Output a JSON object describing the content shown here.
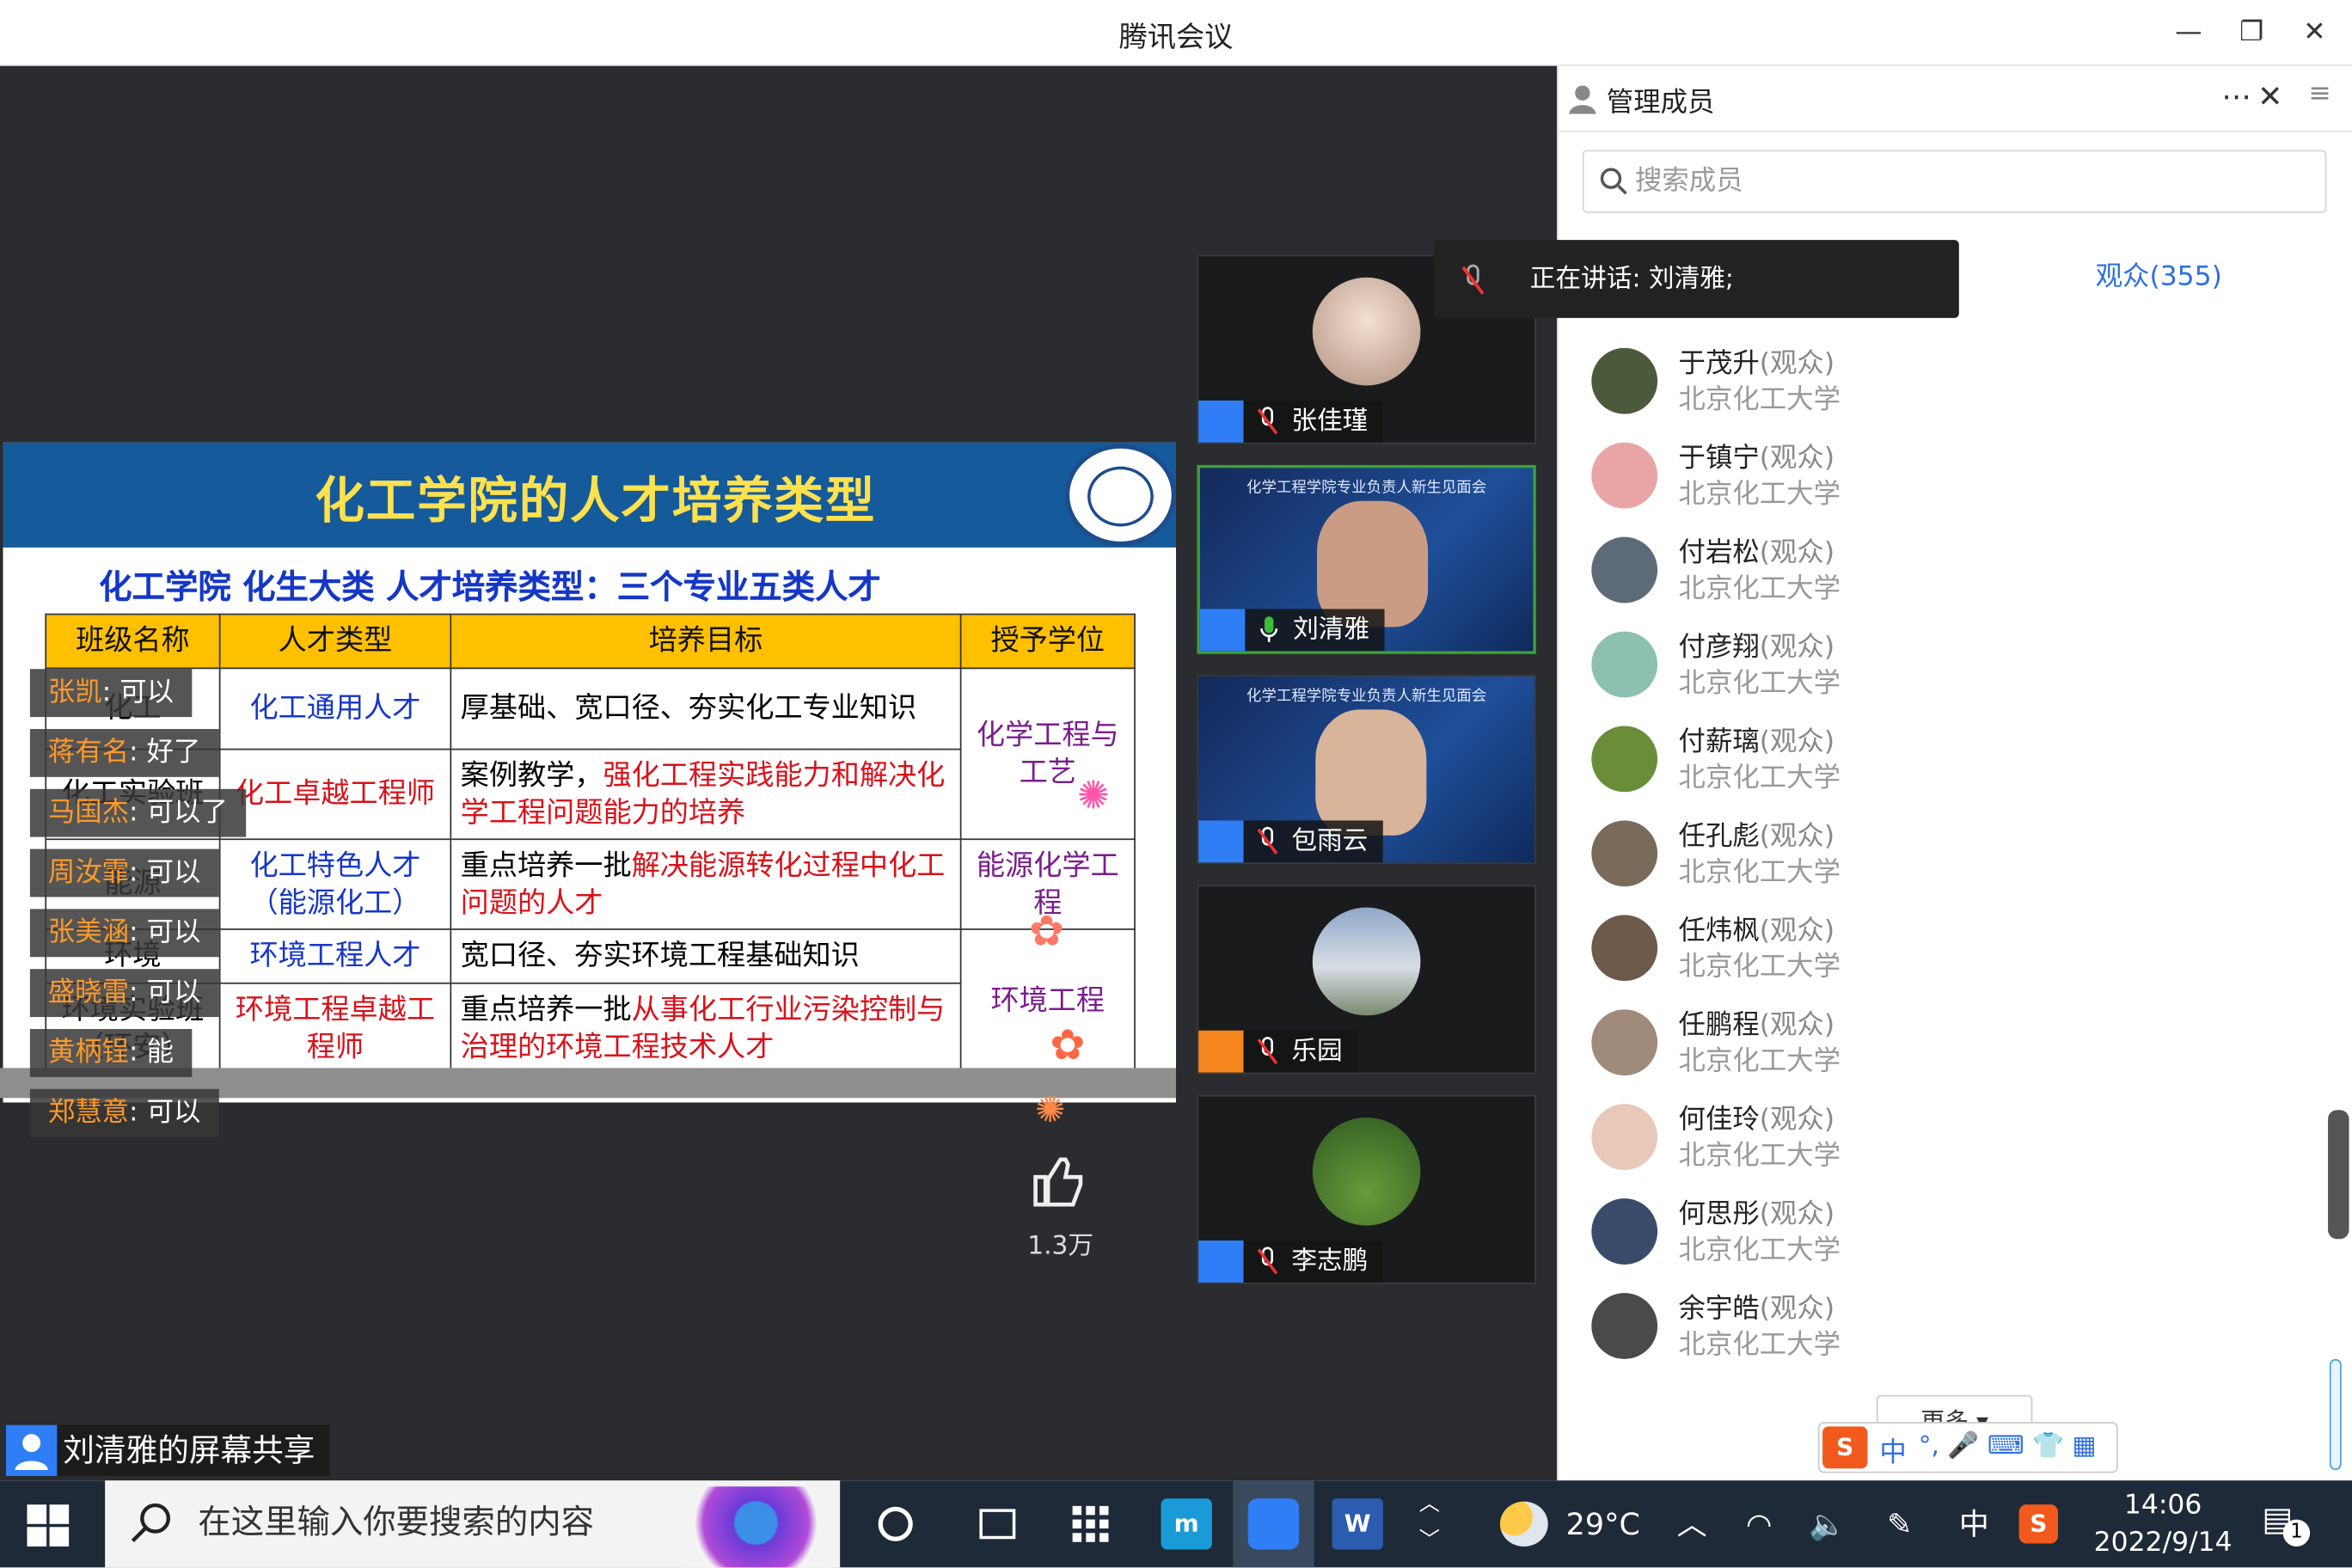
{
  "window": {
    "title": "腾讯会议"
  },
  "slide": {
    "title": "化工学院的人才培养类型",
    "subtitle": "化工学院 化生大类 人才培养类型：三个专业五类人才",
    "headers": [
      "班级名称",
      "人才类型",
      "培养目标",
      "授予学位"
    ],
    "rows": [
      {
        "cls": "化工",
        "type": "化工通用人才",
        "goal_a": "厚基础、宽口径、夯实化工专业知识",
        "goal_b": ""
      },
      {
        "cls": "化工实验班",
        "type": "化工卓越工程师",
        "goal_a": "案例教学，",
        "goal_b": "强化工程实践能力和解决化学工程问题能力的培养"
      },
      {
        "cls": "能源",
        "type": "化工特色人才（能源化工）",
        "goal_a": "重点培养一批",
        "goal_b": "解决能源转化过程中化工问题的人才"
      },
      {
        "cls": "环境",
        "type": "环境工程人才",
        "goal_a": "宽口径、夯实环境工程基础知识",
        "goal_b": ""
      },
      {
        "cls": "环境实验班（环安）",
        "type": "环境工程卓越工程师",
        "goal_a": "重点培养一批",
        "goal_b": "从事化工行业污染控制与治理的环境工程技术人才"
      }
    ],
    "degrees": [
      "化学工程与工艺",
      "能源化学工程",
      "环境工程"
    ]
  },
  "chat": [
    {
      "name": "张凯",
      "sep": ": ",
      "msg": "可以"
    },
    {
      "name": "蒋有名",
      "sep": ": ",
      "msg": "好了"
    },
    {
      "name": "马国杰",
      "sep": ": ",
      "msg": "可以了"
    },
    {
      "name": "周汝霏",
      "sep": ": ",
      "msg": "可以"
    },
    {
      "name": "张美涵",
      "sep": ": ",
      "msg": "可以"
    },
    {
      "name": "盛晓雷",
      "sep": ": ",
      "msg": "可以"
    },
    {
      "name": "黄柄锃",
      "sep": ": ",
      "msg": "能"
    },
    {
      "name": "郑慧意",
      "sep": ": ",
      "msg": "可以"
    }
  ],
  "likes": {
    "count": "1.3万"
  },
  "sharer": {
    "label": "刘清雅的屏幕共享"
  },
  "tiles": [
    {
      "name": "张佳瑾",
      "video_title": ""
    },
    {
      "name": "刘清雅",
      "video_title": "化学工程学院专业负责人新生见面会"
    },
    {
      "name": "包雨云",
      "video_title": "化学工程学院专业负责人新生见面会"
    },
    {
      "name": "乐园",
      "video_title": ""
    },
    {
      "name": "李志鹏",
      "video_title": ""
    }
  ],
  "speaking": {
    "text": "正在讲话: 刘清雅;"
  },
  "panel": {
    "title": "管理成员",
    "search_placeholder": "搜索成员",
    "audience_tab": "观众(355)",
    "more": "更多",
    "members": [
      {
        "name": "于茂升",
        "role": "(观众)",
        "org": "北京化工大学",
        "color": "#4a5a3a"
      },
      {
        "name": "于镇宁",
        "role": "(观众)",
        "org": "北京化工大学",
        "color": "#e9a5a5"
      },
      {
        "name": "付岩松",
        "role": "(观众)",
        "org": "北京化工大学",
        "color": "#5d6b78"
      },
      {
        "name": "付彦翔",
        "role": "(观众)",
        "org": "北京化工大学",
        "color": "#8dc0b0"
      },
      {
        "name": "付薪璃",
        "role": "(观众)",
        "org": "北京化工大学",
        "color": "#6a8d3a"
      },
      {
        "name": "任孔彪",
        "role": "(观众)",
        "org": "北京化工大学",
        "color": "#7a6a5a"
      },
      {
        "name": "任炜枫",
        "role": "(观众)",
        "org": "北京化工大学",
        "color": "#6d5a4a"
      },
      {
        "name": "任鹏程",
        "role": "(观众)",
        "org": "北京化工大学",
        "color": "#a08a7a"
      },
      {
        "name": "何佳玲",
        "role": "(观众)",
        "org": "北京化工大学",
        "color": "#e8c8b8"
      },
      {
        "name": "何思彤",
        "role": "(观众)",
        "org": "北京化工大学",
        "color": "#3a4a6a"
      },
      {
        "name": "余宇皓",
        "role": "(观众)",
        "org": "北京化工大学",
        "color": "#4a4a4a"
      }
    ]
  },
  "ime": {
    "label": "中"
  },
  "taskbar": {
    "search_placeholder": "在这里输入你要搜索的内容",
    "temp": "29°C",
    "ime": "中",
    "time": "14:06",
    "date": "2022/9/14",
    "notif": "1"
  }
}
